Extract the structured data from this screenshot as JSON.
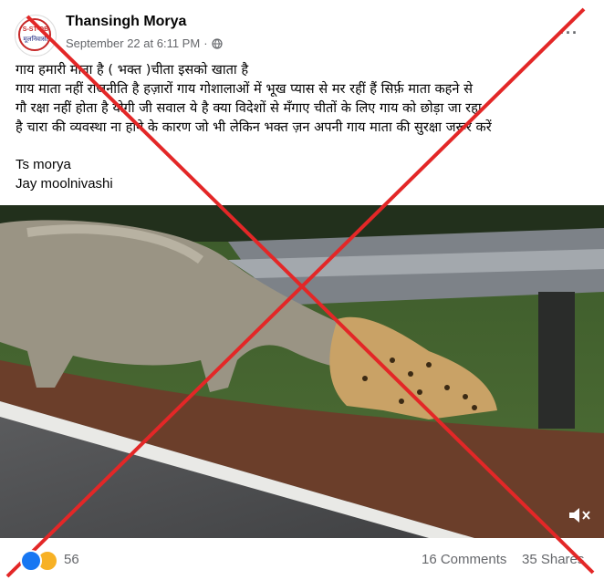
{
  "post": {
    "author": "Thansingh Morya",
    "timestamp": "September 22 at 6:11 PM",
    "separator": "·",
    "privacy_icon": "globe-icon",
    "avatar_text_top": "S-ST-OB",
    "avatar_text_bottom": "मूलनिवासी",
    "more_label": "···",
    "text_lines": [
      "गाय हमारी माता है ( भक्त )चीता इसको खाता है",
      "गाय माता नहीं राजनीति है  हज़ारों गाय गोशालाओं में भूख प्यास से मर रहीं हैं  सिर्फ़ माता कहने से",
      "गौ रक्षा नहीं होता है योगी जी  सवाल ये है क्या विदेशों से मँगाए  चीतों के लिए गाय को छोड़ा जा रहा",
      "है चारा की व्यवस्था ना होने के कारण जो भी लेकिन भक्त ज़न अपनी गाय माता की सुरक्षा जरूर करें"
    ],
    "signature": [
      "Ts morya",
      "Jay moolnivashi"
    ]
  },
  "media": {
    "type": "video",
    "mute_icon": "speaker-muted-icon"
  },
  "footer": {
    "reaction_icons": [
      "like-icon",
      "sad-icon"
    ],
    "reaction_count": "56",
    "comments": "16 Comments",
    "shares": "35 Shares"
  },
  "overlay": {
    "mark": "x-mark",
    "color": "#e32727"
  },
  "colors": {
    "like": "#1877f2",
    "sad": "#f7b125",
    "secondary_text": "#65676b"
  }
}
